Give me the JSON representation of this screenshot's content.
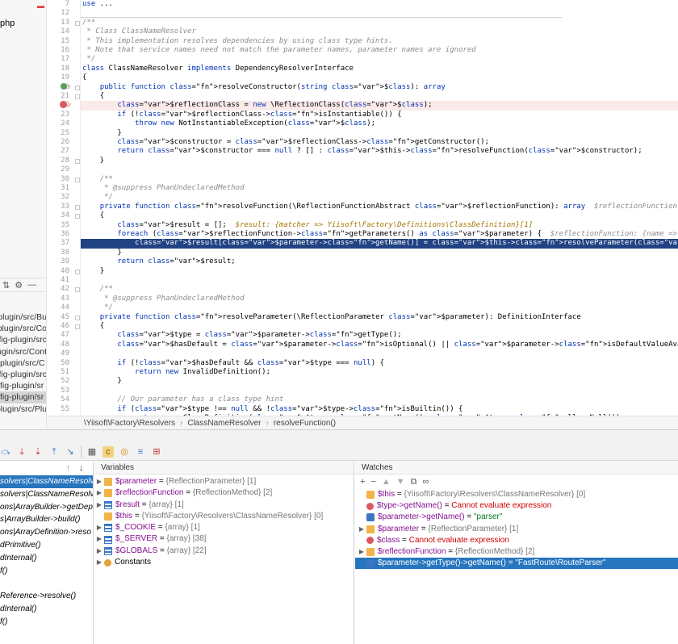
{
  "project": {
    "file_fragment": "php",
    "toolbar_icons": [
      "collapse-icon",
      "gear-icon",
      "minimize-icon"
    ],
    "items": [
      "plugin/src/Bu",
      "plugin/src/Co",
      "fig-plugin/src",
      "plugin/src/Cont",
      "plugin/src/C",
      "nfig-plugin/src",
      "fig-plugin/sr",
      "fig-plugin/sr",
      "plugin/src/Plu"
    ]
  },
  "gutter": {
    "line_numbers": [
      "7",
      "12",
      "13",
      "14",
      "15",
      "16",
      "17",
      "18",
      "19",
      "20",
      "21",
      "22",
      "23",
      "24",
      "25",
      "26",
      "27",
      "28",
      "29",
      "30",
      "31",
      "32",
      "33",
      "34",
      "35",
      "36",
      "37",
      "38",
      "39",
      "40",
      "41",
      "42",
      "43",
      "44",
      "45",
      "46",
      "47",
      "48",
      "49",
      "50",
      "51",
      "52",
      "53",
      "54",
      "55"
    ]
  },
  "code": {
    "lines": [
      "use ...",
      "",
      "/**",
      " * Class ClassNameResolver",
      " * This implementation resolves dependencies by using class type hints.",
      " * Note that service names need not match the parameter names, parameter names are ignored",
      " */",
      "class ClassNameResolver implements DependencyResolverInterface",
      "{",
      "    public function resolveConstructor(string $class): array",
      "    {",
      "        $reflectionClass = new \\ReflectionClass($class);",
      "        if (!$reflectionClass->isInstantiable()) {",
      "            throw new NotInstantiableException($class);",
      "        }",
      "        $constructor = $reflectionClass->getConstructor();",
      "        return $constructor === null ? [] : $this->resolveFunction($constructor);",
      "    }",
      "",
      "    /**",
      "     * @suppress PhanUndeclaredMethod",
      "     */",
      "    private function resolveFunction(\\ReflectionFunctionAbstract $reflectionFunction): array  $reflectionFunction: {name => \"__construct\", class => \"",
      "    {",
      "        $result = [];  $result: {matcher => Yiisoft\\Factory\\Definitions\\ClassDefinition}[1]",
      "        foreach ($reflectionFunction->getParameters() as $parameter) {  $reflectionFunction: {name => \"__construct\", class => \"Yiisoft\\Router\\FastRout",
      "            $result[$parameter->getName()] = $this->resolveParameter($parameter);",
      "        }",
      "        return $result;",
      "    }",
      "",
      "    /**",
      "     * @suppress PhanUndeclaredMethod",
      "     */",
      "    private function resolveParameter(\\ReflectionParameter $parameter): DefinitionInterface",
      "    {",
      "        $type = $parameter->getType();",
      "        $hasDefault = $parameter->isOptional() || $parameter->isDefaultValueAvailable() || (isset($type) && $type->allowsNull());",
      "",
      "        if (!$hasDefault && $type === null) {",
      "            return new InvalidDefinition();",
      "        }",
      "",
      "        // Our parameter has a class type hint",
      "        if ($type !== null && !$type->isBuiltin()) {",
      "            return new ClassDefinition($type->getName(), $type->allowsNull());"
    ]
  },
  "breadcrumb": {
    "items": [
      "\\Yiisoft\\Factory\\Resolvers",
      "ClassNameResolver",
      "resolveFunction()"
    ]
  },
  "debugger": {
    "toolbar_icons": [
      "step-over-icon",
      "step-into-icon",
      "force-step-into-icon",
      "step-out-icon",
      "run-to-cursor-icon",
      "evaluate-icon",
      "frames-icon",
      "watch-icon",
      "mute-icon",
      "settings-icon"
    ],
    "frames": {
      "items": [
        "solvers|ClassNameResolv",
        "solvers|ClassNameResolv",
        "ons|ArrayBuilder->getDep",
        "s|ArrayBuilder->build()",
        "ons|ArrayDefinition->reso",
        "dPrimitive()",
        "dInternal()",
        "f()",
        "",
        "Reference->resolve()",
        "dInternal()",
        "f()"
      ]
    },
    "variables": {
      "title": "Variables",
      "items": [
        {
          "name": "$parameter",
          "value": "{ReflectionParameter} [1]",
          "icon": "field",
          "expandable": true
        },
        {
          "name": "$reflectionFunction",
          "value": "{ReflectionMethod} [2]",
          "icon": "field",
          "expandable": true
        },
        {
          "name": "$result",
          "value": "{array} [1]",
          "icon": "array",
          "expandable": true
        },
        {
          "name": "$this",
          "value": "{Yiisoft\\Factory\\Resolvers\\ClassNameResolver} [0]",
          "icon": "field",
          "expandable": false
        },
        {
          "name": "$_COOKIE",
          "value": "{array} [1]",
          "icon": "array",
          "expandable": true
        },
        {
          "name": "$_SERVER",
          "value": "{array} [38]",
          "icon": "array",
          "expandable": true
        },
        {
          "name": "$GLOBALS",
          "value": "{array} [22]",
          "icon": "array",
          "expandable": true
        },
        {
          "name": "Constants",
          "value": "",
          "icon": "const",
          "expandable": true
        }
      ]
    },
    "watches": {
      "title": "Watches",
      "toolbar": [
        "+",
        "−",
        "▲",
        "▼",
        "copy-icon",
        "glasses-icon"
      ],
      "items": [
        {
          "expr": "$this",
          "value": "{Yiisoft\\Factory\\Resolvers\\ClassNameResolver} [0]",
          "kind": "type",
          "icon": "field",
          "expandable": false
        },
        {
          "expr": "$type->getName()",
          "value": "Cannot evaluate expression",
          "kind": "error",
          "icon": "err",
          "expandable": false
        },
        {
          "expr": "$parameter->getName()",
          "value": "\"parser\"",
          "kind": "string",
          "icon": "watch",
          "expandable": false
        },
        {
          "expr": "$parameter",
          "value": "{ReflectionParameter} [1]",
          "kind": "type",
          "icon": "field",
          "expandable": true
        },
        {
          "expr": "$class",
          "value": "Cannot evaluate expression",
          "kind": "error",
          "icon": "err",
          "expandable": false
        },
        {
          "expr": "$reflectionFunction",
          "value": "{ReflectionMethod} [2]",
          "kind": "type",
          "icon": "field",
          "expandable": true
        },
        {
          "expr": "$parameter->getType()->getName()",
          "value": "\"FastRoute\\RouteParser\"",
          "kind": "string",
          "icon": "watch",
          "expandable": false
        }
      ]
    }
  }
}
